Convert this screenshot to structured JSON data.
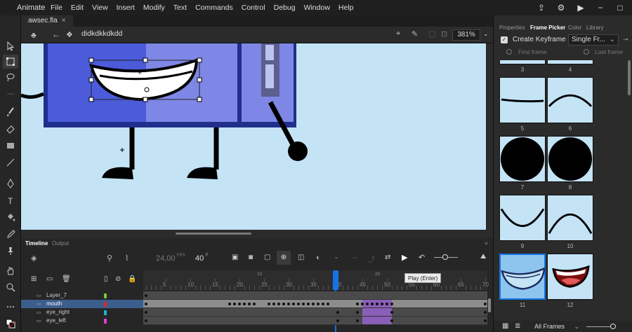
{
  "app": {
    "name": "Animate"
  },
  "menu": [
    "File",
    "Edit",
    "View",
    "Insert",
    "Modify",
    "Text",
    "Commands",
    "Control",
    "Debug",
    "Window",
    "Help"
  ],
  "document": {
    "tab": "awsec.fla",
    "symbol": "didkdkkdkdd",
    "zoom": "381%"
  },
  "timeline": {
    "tabs": [
      "Timeline",
      "Output"
    ],
    "fps": "24,00",
    "fps_unit": "FPS",
    "frame": "40",
    "frame_unit": "F",
    "ruler_ticks": [
      "5",
      "10",
      "15",
      "20",
      "25",
      "30",
      "35",
      "40",
      "45",
      "50",
      "55",
      "60",
      "65",
      "70"
    ],
    "second_marks": [
      "1s",
      "2s"
    ],
    "playhead_frame": 40,
    "layers": [
      {
        "name": "Layer_7",
        "color": "#7cc242"
      },
      {
        "name": "mouth",
        "color": "#e0242a"
      },
      {
        "name": "eye_right",
        "color": "#1bb5c9"
      },
      {
        "name": "eye_left",
        "color": "#e040d0"
      }
    ],
    "tooltip": "Play (Enter)"
  },
  "panel": {
    "tabs": [
      "Properties",
      "Frame Picker",
      "Color",
      "Library"
    ],
    "active_tab": "Frame Picker",
    "create_keyframe": "Create Keyframe",
    "mode": "Single Fr...",
    "first_frame": "First frame",
    "last_frame": "Last frame",
    "frames": [
      "3",
      "4",
      "5",
      "6",
      "7",
      "8",
      "9",
      "10",
      "11",
      "12"
    ],
    "selected_frame": "11",
    "footer": "All Frames"
  },
  "colors": {
    "accent": "#1473e6",
    "stage": "#c4e4f6",
    "body": "#4b5bd9"
  }
}
